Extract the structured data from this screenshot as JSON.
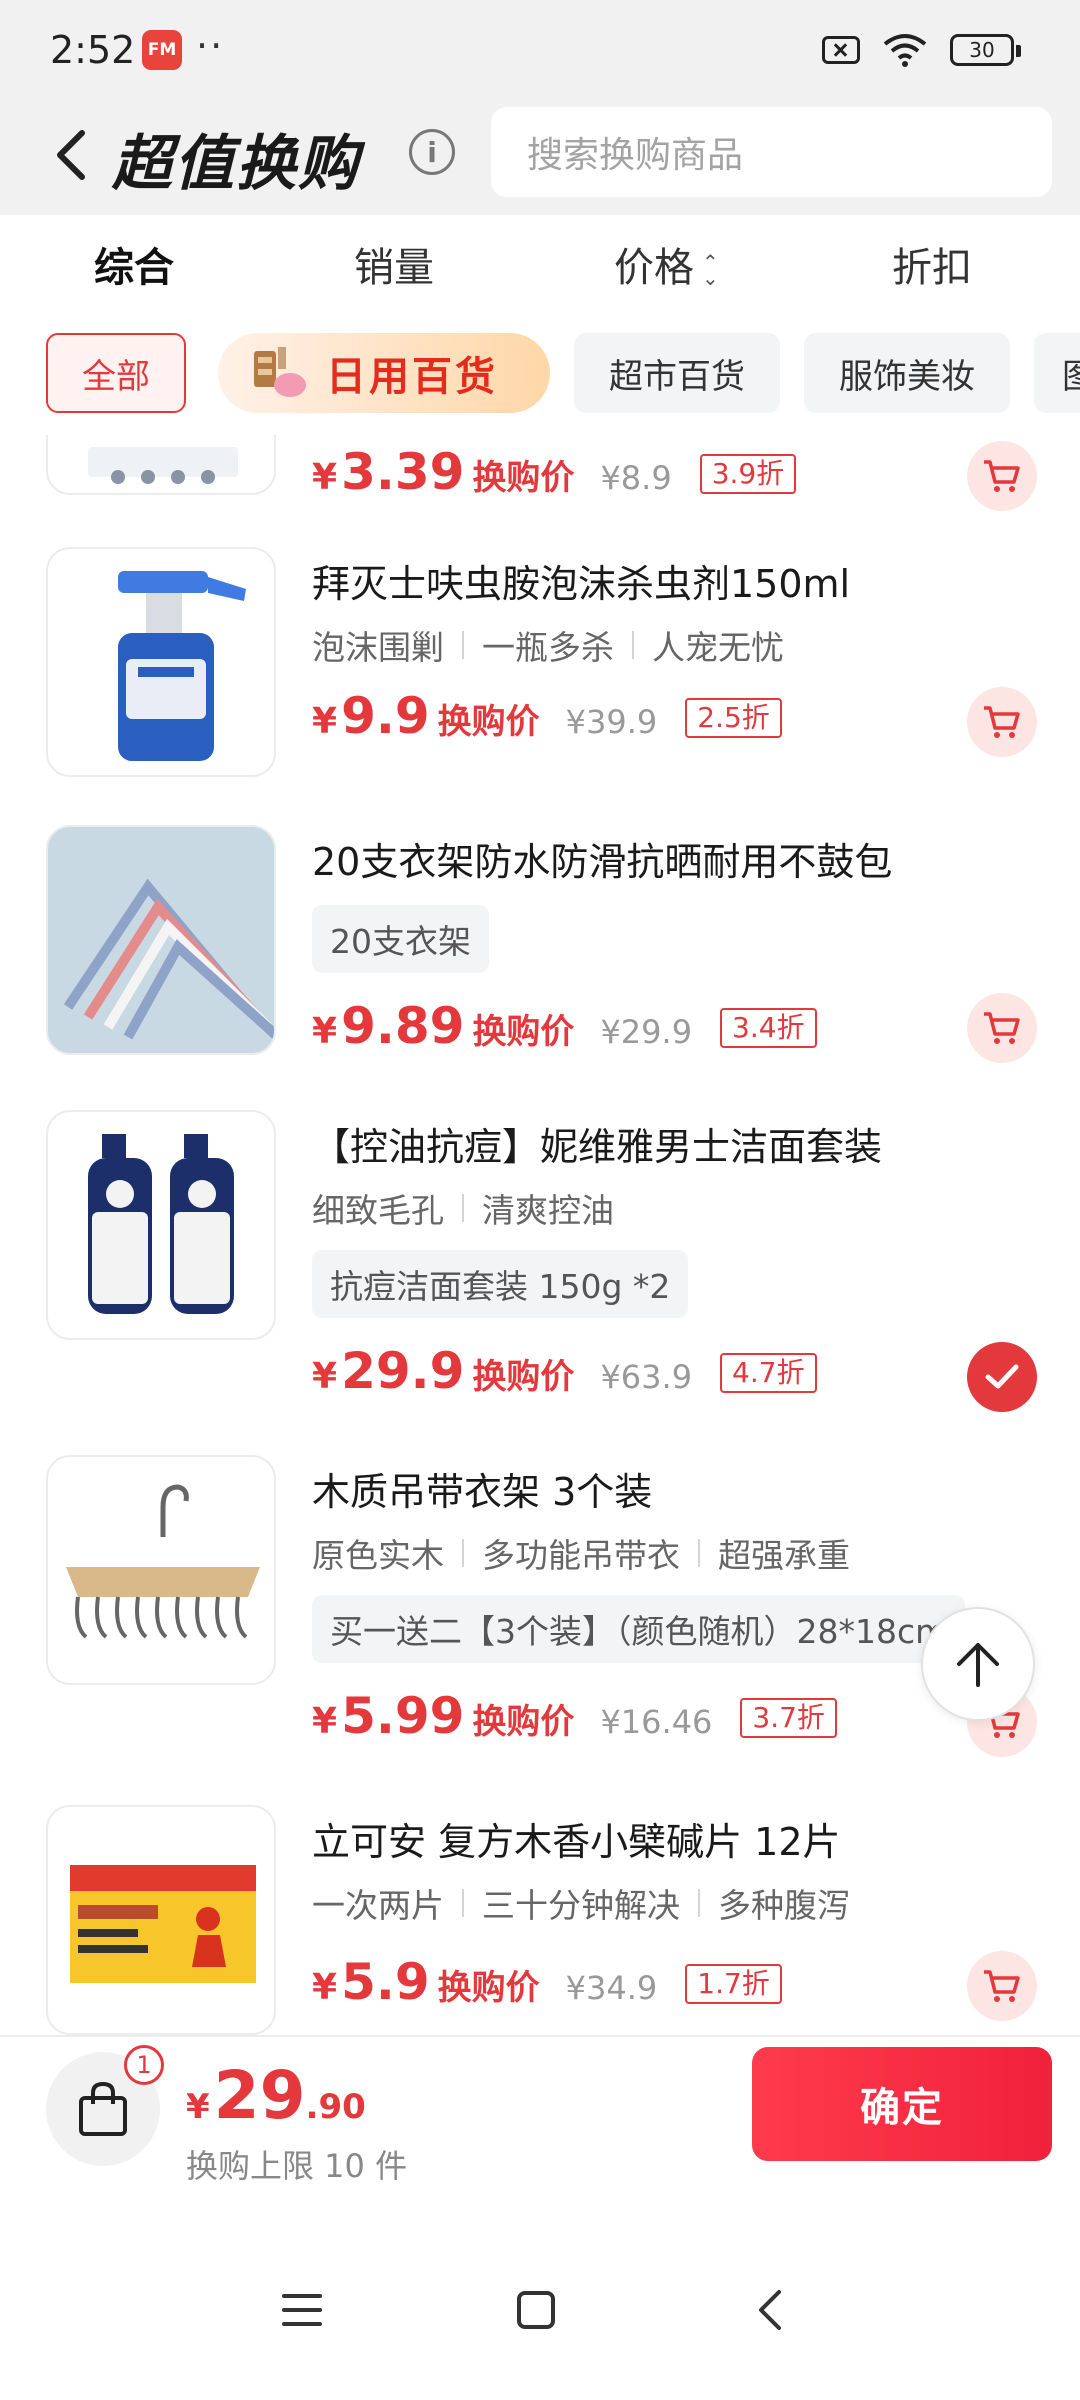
{
  "status_bar": {
    "time": "2:52",
    "app_icon_text": "FM",
    "dots": "··",
    "battery": "30"
  },
  "header": {
    "title": "超值换购",
    "search_placeholder": "搜索换购商品"
  },
  "sort_tabs": [
    {
      "label": "综合",
      "active": true
    },
    {
      "label": "销量",
      "active": false
    },
    {
      "label": "价格",
      "active": false
    },
    {
      "label": "折扣",
      "active": false
    }
  ],
  "categories": [
    {
      "label": "全部",
      "active": true
    },
    {
      "label": "日用百货",
      "featured": true
    },
    {
      "label": "超市百货"
    },
    {
      "label": "服饰美妆"
    },
    {
      "label": "图"
    }
  ],
  "products": [
    {
      "title": "",
      "tags": [],
      "spec": "",
      "price": "3.39",
      "price_label": "换购价",
      "original_price": "¥8.9",
      "discount": "3.9折",
      "selected": false
    },
    {
      "title": "拜灭士呋虫胺泡沫杀虫剂150ml",
      "tags": [
        "泡沫围剿",
        "一瓶多杀",
        "人宠无忧"
      ],
      "spec": "",
      "price": "9.9",
      "price_label": "换购价",
      "original_price": "¥39.9",
      "discount": "2.5折",
      "selected": false
    },
    {
      "title": "20支衣架防水防滑抗晒耐用不鼓包",
      "tags": [],
      "spec": "20支衣架",
      "price": "9.89",
      "price_label": "换购价",
      "original_price": "¥29.9",
      "discount": "3.4折",
      "selected": false
    },
    {
      "title": "【控油抗痘】妮维雅男士洁面套装",
      "tags": [
        "细致毛孔",
        "清爽控油"
      ],
      "spec": "抗痘洁面套装 150g *2",
      "price": "29.9",
      "price_label": "换购价",
      "original_price": "¥63.9",
      "discount": "4.7折",
      "selected": true
    },
    {
      "title": "木质吊带衣架 3个装",
      "tags": [
        "原色实木",
        "多功能吊带衣",
        "超强承重"
      ],
      "spec": "买一送二【3个装】（颜色随机）28*18cm",
      "price": "5.99",
      "price_label": "换购价",
      "original_price": "¥16.46",
      "discount": "3.7折",
      "selected": false
    },
    {
      "title": "立可安 复方木香小檗碱片 12片",
      "tags": [
        "一次两片",
        "三十分钟解决",
        "多种腹泻"
      ],
      "spec": "",
      "price": "5.9",
      "price_label": "换购价",
      "original_price": "¥34.9",
      "discount": "1.7折",
      "selected": false
    }
  ],
  "bottom": {
    "cart_count": "1",
    "currency": "¥",
    "total_int": "29",
    "total_dec": ".90",
    "limit_text": "换购上限 10 件",
    "confirm_label": "确定"
  },
  "icons": {
    "back": "back-arrow-icon",
    "info": "info-icon",
    "cart": "cart-icon",
    "check": "check-icon",
    "top": "arrow-up-icon",
    "bag": "shopping-bag-icon",
    "nav_menu": "menu-icon",
    "nav_home": "home-icon",
    "nav_back": "nav-back-icon"
  },
  "colors": {
    "accent": "#e4393c",
    "header_bg": "#f1f1f1",
    "chip_bg": "#f3f4f6"
  }
}
